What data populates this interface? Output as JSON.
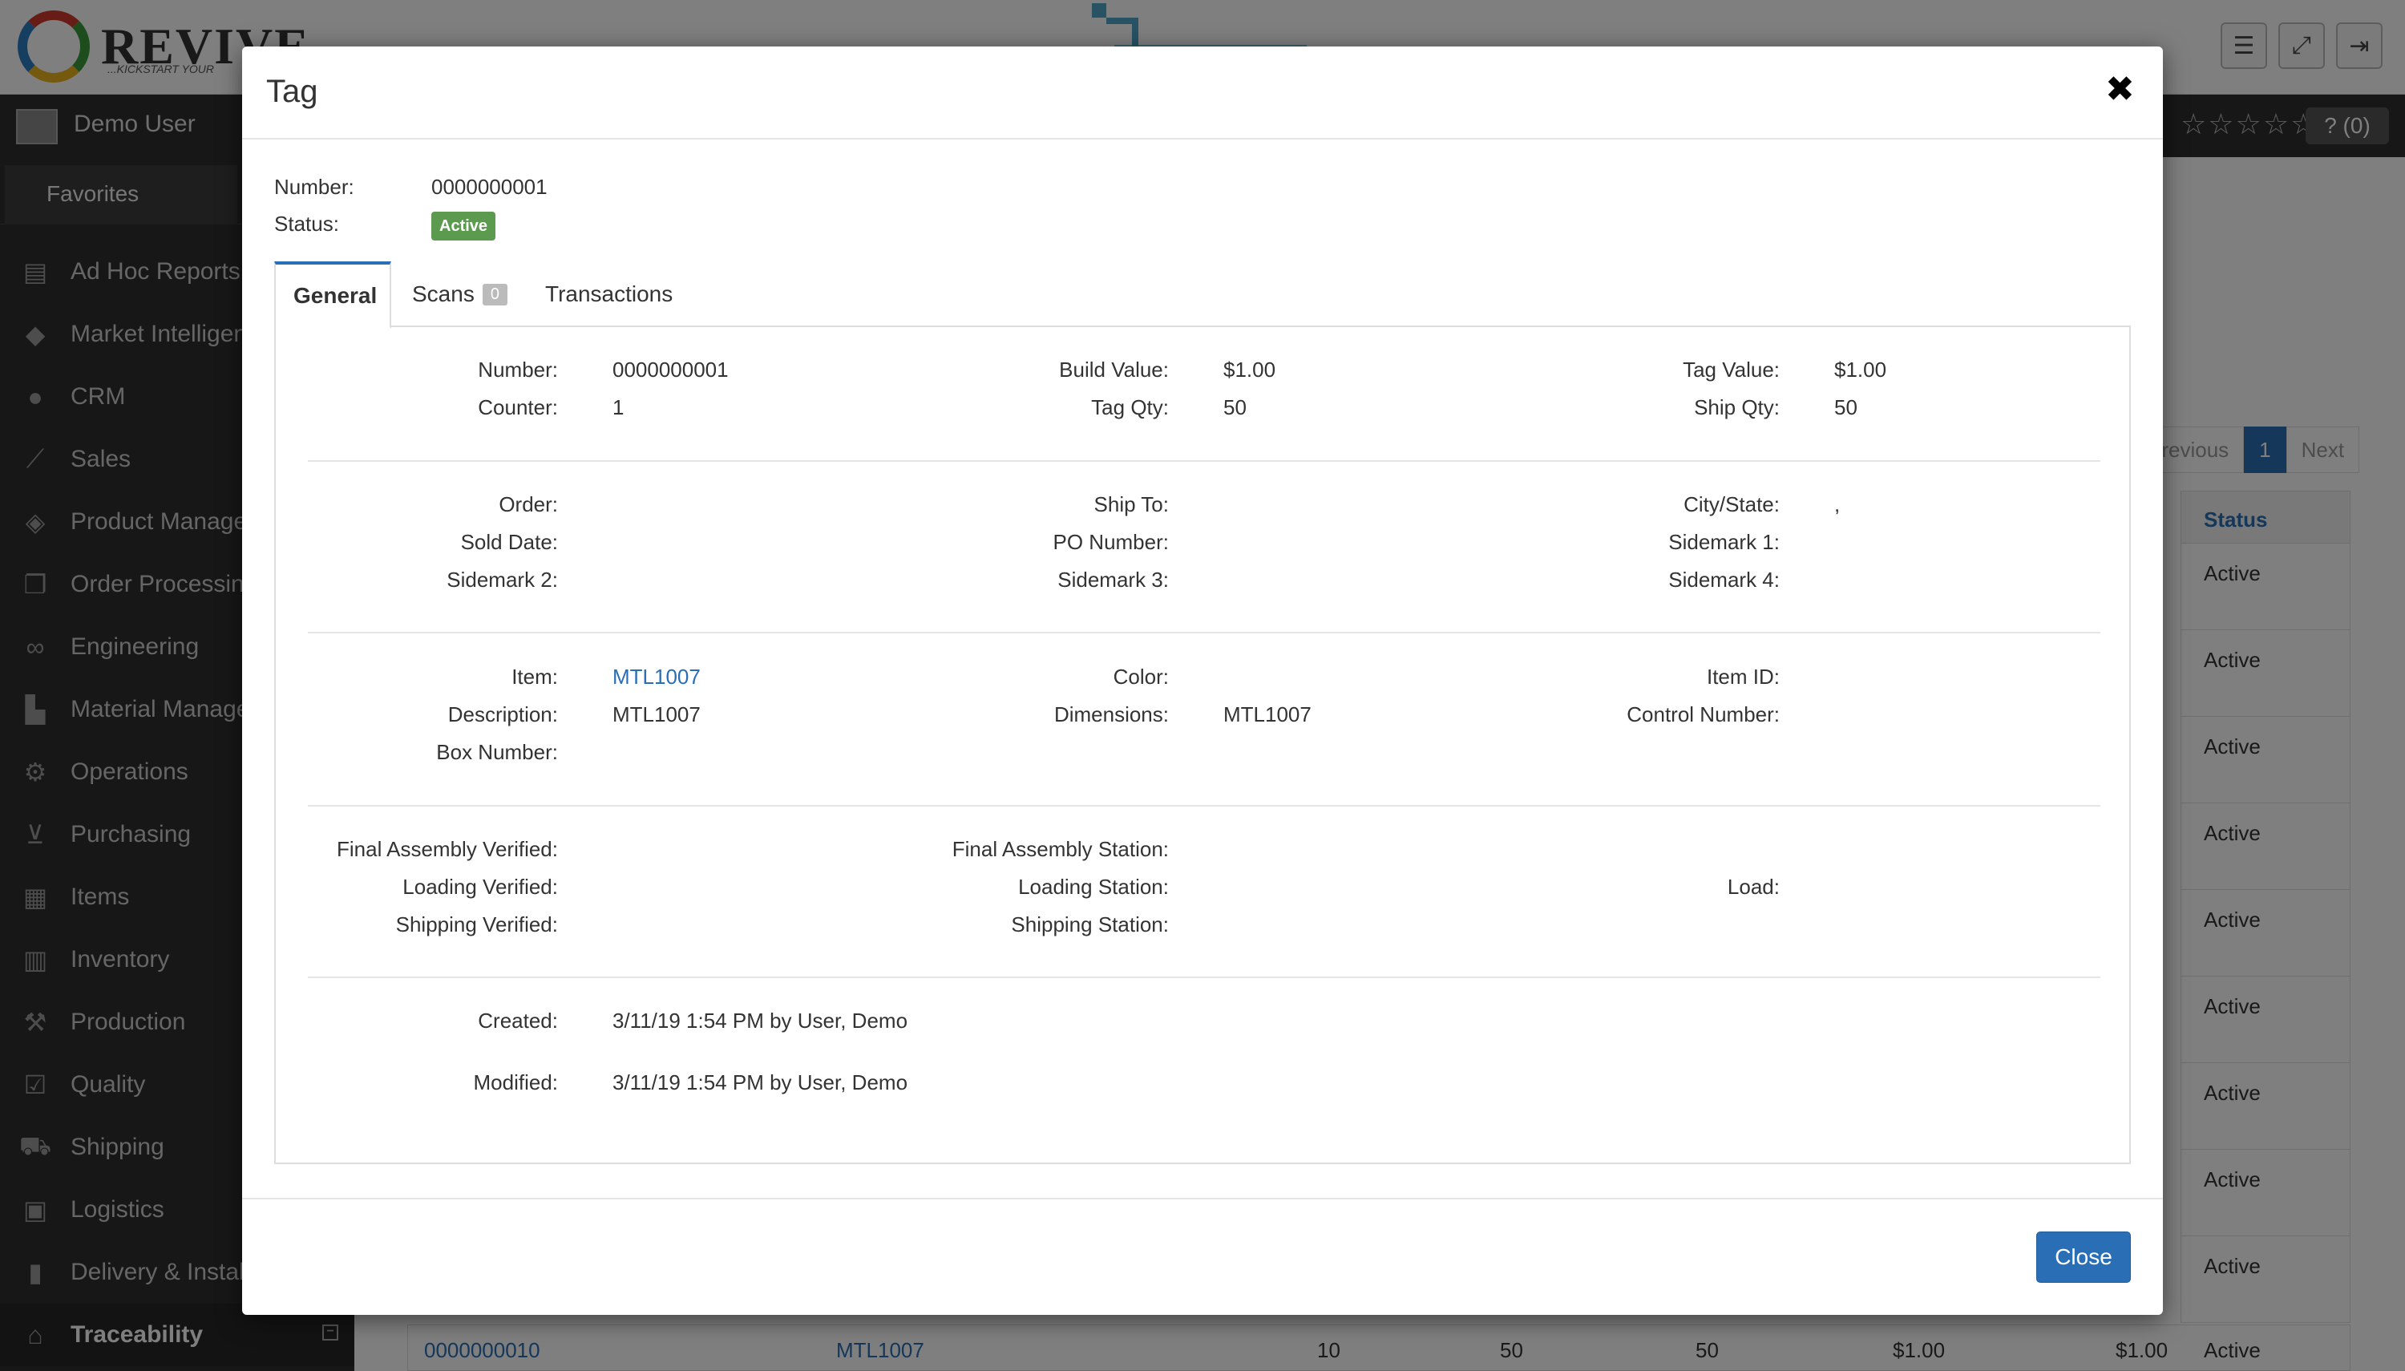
{
  "app": {
    "logo_text": "REVIVE",
    "logo_tagline": "...KICKSTART YOUR",
    "user_name": "Demo User",
    "rating_stars": "☆☆☆☆☆",
    "help_badge": "? (0)"
  },
  "sidebar": {
    "favorites_label": "Favorites",
    "items": [
      {
        "label": "Ad Hoc Reports",
        "icon": "reports-icon"
      },
      {
        "label": "Market Intelligence",
        "icon": "graduation-cap-icon"
      },
      {
        "label": "CRM",
        "icon": "user-icon"
      },
      {
        "label": "Sales",
        "icon": "line-chart-icon"
      },
      {
        "label": "Product Management",
        "icon": "cube-icon"
      },
      {
        "label": "Order Processing",
        "icon": "copy-icon"
      },
      {
        "label": "Engineering",
        "icon": "link-icon"
      },
      {
        "label": "Material Management",
        "icon": "industry-icon"
      },
      {
        "label": "Operations",
        "icon": "gears-icon"
      },
      {
        "label": "Purchasing",
        "icon": "cart-icon"
      },
      {
        "label": "Items",
        "icon": "cubes-icon"
      },
      {
        "label": "Inventory",
        "icon": "boxes-icon"
      },
      {
        "label": "Production",
        "icon": "wrench-icon"
      },
      {
        "label": "Quality",
        "icon": "checkbox-icon"
      },
      {
        "label": "Shipping",
        "icon": "truck-icon"
      },
      {
        "label": "Logistics",
        "icon": "calendar-check-icon"
      },
      {
        "label": "Delivery & Installation",
        "icon": "building-icon"
      },
      {
        "label": "Traceability",
        "icon": "tags-icon"
      }
    ]
  },
  "background": {
    "pager": {
      "prev": "Previous",
      "current": "1",
      "next": "Next"
    },
    "status_header": "Status",
    "row_status": "Active",
    "bottom_row": {
      "number": "0000000010",
      "item": "MTL1007",
      "v1": "10",
      "v2": "50",
      "v3": "50",
      "v4": "$1.00",
      "v5": "$1.00",
      "status": "Active"
    }
  },
  "modal": {
    "title": "Tag",
    "close_x": "✖",
    "number_label": "Number:",
    "number_value": "0000000001",
    "status_label": "Status:",
    "status_value": "Active",
    "tabs": {
      "general": "General",
      "scans": "Scans",
      "scans_count": "0",
      "transactions": "Transactions"
    },
    "general": {
      "number_label": "Number:",
      "number": "0000000001",
      "counter_label": "Counter:",
      "counter": "1",
      "build_value_label": "Build Value:",
      "build_value": "$1.00",
      "tag_qty_label": "Tag Qty:",
      "tag_qty": "50",
      "tag_value_label": "Tag Value:",
      "tag_value": "$1.00",
      "ship_qty_label": "Ship Qty:",
      "ship_qty": "50",
      "order_label": "Order:",
      "order": "",
      "sold_date_label": "Sold Date:",
      "sold_date": "",
      "sidemark2_label": "Sidemark 2:",
      "sidemark2": "",
      "ship_to_label": "Ship To:",
      "ship_to": "",
      "po_number_label": "PO Number:",
      "po_number": "",
      "sidemark3_label": "Sidemark 3:",
      "sidemark3": "",
      "city_state_label": "City/State:",
      "city_state": ",",
      "sidemark1_label": "Sidemark 1:",
      "sidemark1": "",
      "sidemark4_label": "Sidemark 4:",
      "sidemark4": "",
      "item_label": "Item:",
      "item": "MTL1007",
      "description_label": "Description:",
      "description": "MTL1007",
      "box_number_label": "Box Number:",
      "box_number": "",
      "color_label": "Color:",
      "color": "",
      "dimensions_label": "Dimensions:",
      "dimensions": "MTL1007",
      "item_id_label": "Item ID:",
      "item_id": "",
      "control_number_label": "Control Number:",
      "control_number": "",
      "final_assembly_verified_label": "Final Assembly Verified:",
      "loading_verified_label": "Loading Verified:",
      "shipping_verified_label": "Shipping Verified:",
      "final_assembly_station_label": "Final Assembly Station:",
      "loading_station_label": "Loading Station:",
      "shipping_station_label": "Shipping Station:",
      "load_label": "Load:",
      "created_label": "Created:",
      "created": "3/11/19 1:54 PM by User, Demo",
      "modified_label": "Modified:",
      "modified": "3/11/19 1:54 PM by User, Demo"
    },
    "close_button": "Close"
  },
  "colors": {
    "accent": "#2a6eb5",
    "status_active": "#5b9a4f",
    "sidebar_bg": "#2e2e2e"
  }
}
